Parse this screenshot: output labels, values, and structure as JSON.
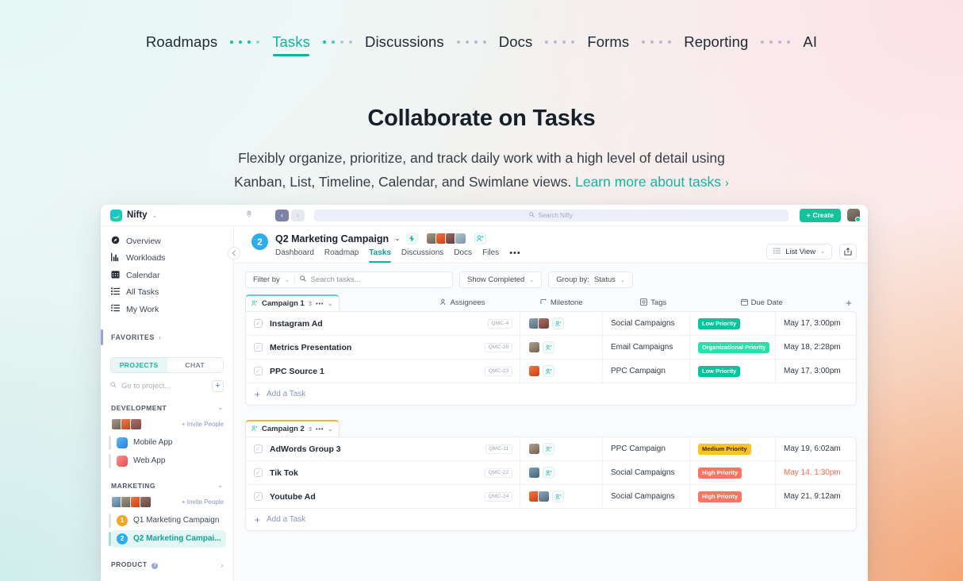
{
  "topnav": {
    "items": [
      {
        "label": "Roadmaps",
        "active": false
      },
      {
        "label": "Tasks",
        "active": true
      },
      {
        "label": "Discussions",
        "active": false
      },
      {
        "label": "Docs",
        "active": false
      },
      {
        "label": "Forms",
        "active": false
      },
      {
        "label": "Reporting",
        "active": false
      },
      {
        "label": "AI",
        "active": false
      }
    ]
  },
  "hero": {
    "title": "Collaborate on Tasks",
    "line1": "Flexibly organize, prioritize, and track daily work with a high level of detail using",
    "line2": "Kanban, List, Timeline, Calendar, and Swimlane views.",
    "link": "Learn more about tasks",
    "link_chevron": "›"
  },
  "app": {
    "topbar": {
      "brand": "Nifty",
      "brand_caret": "⌄",
      "bell_icon": "🔔",
      "back_icon": "‹",
      "forward_icon": "›",
      "search_icon": "⌕",
      "search_placeholder": "Search Nifty",
      "create_label": "Create",
      "create_plus": "+"
    },
    "sidebar": {
      "items": [
        {
          "label": "Overview",
          "icon": "compass-icon",
          "glyph": "◕"
        },
        {
          "label": "Workloads",
          "icon": "chart-bars-icon",
          "glyph": "█"
        },
        {
          "label": "Calendar",
          "icon": "calendar-icon",
          "glyph": "▦"
        },
        {
          "label": "All Tasks",
          "icon": "list-icon",
          "glyph": "☰"
        },
        {
          "label": "My Work",
          "icon": "checklist-icon",
          "glyph": "☰"
        }
      ],
      "favorites_label": "FAVORITES",
      "favorites_chevron": "›",
      "segments": [
        {
          "label": "PROJECTS",
          "active": true
        },
        {
          "label": "CHAT",
          "active": false
        }
      ],
      "project_search_placeholder": "Go to project...",
      "project_search_icon": "⌕",
      "add_project_icon": "+",
      "groups": [
        {
          "name": "DEVELOPMENT",
          "chevron": "⌄",
          "invite_label": "+ Invite People",
          "avatars": [
            "#8f8477",
            "#d8603a",
            "#9c5f57"
          ],
          "projects": [
            {
              "label": "Mobile App",
              "type": "icon",
              "color": "#3b9ef5"
            },
            {
              "label": "Web App",
              "type": "icon",
              "color": "#f06a6a"
            }
          ]
        },
        {
          "name": "MARKETING",
          "chevron": "⌄",
          "invite_label": "+ Invite People",
          "avatars": [
            "#6b93b8",
            "#8f8477",
            "#e05a2b",
            "#7b5f55"
          ],
          "projects": [
            {
              "label": "Q1 Marketing Campaign",
              "type": "badge",
              "badge": "1",
              "color": "#f5a623",
              "selected": false
            },
            {
              "label": "Q2 Marketing Campai...",
              "type": "badge",
              "badge": "2",
              "color": "#2badf0",
              "selected": true
            }
          ]
        },
        {
          "name": "PRODUCT",
          "chevron": "›",
          "help_icon": "?",
          "invite_label": "",
          "avatars": [],
          "projects": []
        }
      ]
    },
    "project": {
      "badge": "2",
      "title": "Q2 Marketing Campaign",
      "title_caret": "⌄",
      "bolt_icon": "⚡",
      "avatars": [
        "#8f8477",
        "#e25a28",
        "#7b5050",
        "#9fb4c4"
      ],
      "add_person_icon": "&⁺",
      "tabs": [
        {
          "label": "Dashboard",
          "active": false
        },
        {
          "label": "Roadmap",
          "active": false
        },
        {
          "label": "Tasks",
          "active": true
        },
        {
          "label": "Discussions",
          "active": false
        },
        {
          "label": "Docs",
          "active": false
        },
        {
          "label": "Files",
          "active": false
        }
      ],
      "more_icon": "•••",
      "view_label": "List View",
      "view_caret": "⌄",
      "view_icon": "☰",
      "share_icon": "↗"
    },
    "toolbar": {
      "filter_label": "Filter by",
      "filter_caret": "⌄",
      "search_icon": "⌕",
      "search_placeholder": "Search tasks...",
      "show_completed_label": "Show Completed",
      "show_completed_caret": "⌄",
      "group_by_label": "Group by:",
      "group_by_value": "Status",
      "group_by_caret": "⌄"
    },
    "columns": {
      "assignees": "Assignees",
      "assignees_icon": "⁂",
      "milestone": "Milestone",
      "milestone_icon": "⤴",
      "tags": "Tags",
      "tags_icon": "◎",
      "due_date": "Due Date",
      "due_date_icon": "Ὄ5",
      "add_column_icon": "+"
    },
    "groups": [
      {
        "name": "Campaign 1",
        "icon": "&⁺",
        "count": "3",
        "more": "•••",
        "caret": "⌄",
        "accent": "#5ecbe4",
        "add_task_label": "Add a Task",
        "add_task_plus": "+",
        "tasks": [
          {
            "name": "Instagram Ad",
            "code": "QMC-4",
            "assignees": [
              "#6c7f8e",
              "#8a5a4f"
            ],
            "milestone": "Social Campaigns",
            "tag": "Low Priority",
            "tag_color": "#09c39d",
            "due": "May 17, 3:00pm",
            "overdue": false
          },
          {
            "name": "Metrics Presentation",
            "code": "QMC-20",
            "assignees": [
              "#8f8477"
            ],
            "milestone": "Email Campaigns",
            "tag": "Organizational Priority",
            "tag_color": "#2ae0a8",
            "due": "May 18, 2:28pm",
            "overdue": false
          },
          {
            "name": "PPC Source 1",
            "code": "QMC-23",
            "assignees": [
              "#e25a28"
            ],
            "milestone": "PPC Campaign",
            "tag": "Low Priority",
            "tag_color": "#09c39d",
            "due": "May 17, 3:00pm",
            "overdue": false
          }
        ]
      },
      {
        "name": "Campaign 2",
        "icon": "&⁺",
        "count": "3",
        "more": "•••",
        "caret": "⌄",
        "accent": "#f5b823",
        "add_task_label": "Add a Task",
        "add_task_plus": "+",
        "tasks": [
          {
            "name": "AdWords Group 3",
            "code": "QMC-11",
            "assignees": [
              "#8f8477"
            ],
            "milestone": "PPC Campaign",
            "tag": "Medium Priority",
            "tag_color": "#fcc324",
            "tag_text_color": "#3a2c00",
            "due": "May 19, 6:02am",
            "overdue": false
          },
          {
            "name": "Tik Tok",
            "code": "QMC-22",
            "assignees": [
              "#5d7f96"
            ],
            "milestone": "Social Campaigns",
            "tag": "High Priority",
            "tag_color": "#fc7563",
            "due": "May 14, 1:30pm",
            "overdue": true
          },
          {
            "name": "Youtube Ad",
            "code": "QMC-24",
            "assignees": [
              "#e25a28",
              "#6c7f8e"
            ],
            "milestone": "Social Campaigns",
            "tag": "High Priority",
            "tag_color": "#fc7563",
            "due": "May 21, 9:12am",
            "overdue": false
          }
        ]
      }
    ]
  }
}
